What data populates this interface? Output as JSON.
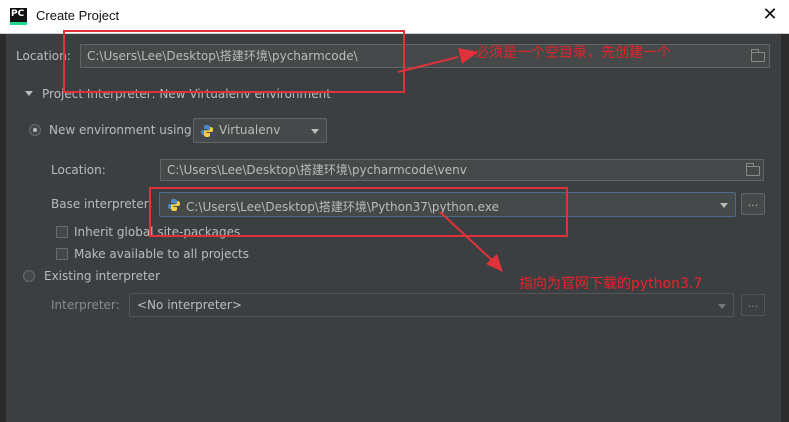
{
  "window": {
    "title": "Create Project",
    "logo_text": "PC",
    "close_glyph": "✕"
  },
  "location": {
    "label": "Location:",
    "value": "C:\\Users\\Lee\\Desktop\\搭建环境\\pycharmcode\\"
  },
  "section": {
    "label": "Project Interpreter: New Virtualenv environment"
  },
  "new_env": {
    "label": "New environment using",
    "tool": "Virtualenv",
    "location_label": "Location:",
    "location_value": "C:\\Users\\Lee\\Desktop\\搭建环境\\pycharmcode\\venv",
    "base_label": "Base interpreter:",
    "base_value": "C:\\Users\\Lee\\Desktop\\搭建环境\\Python37\\python.exe",
    "inherit_label": "Inherit global site-packages",
    "make_available_label": "Make available to all projects",
    "browse_label": "..."
  },
  "existing": {
    "label": "Existing interpreter",
    "interpreter_label": "Interpreter:",
    "interpreter_value": "<No interpreter>",
    "browse_label": "..."
  },
  "annotations": {
    "note1": "必须是一个空目录，先创建一个",
    "note2": "指向为官网下载的python3.7",
    "color": "#e0323a"
  }
}
